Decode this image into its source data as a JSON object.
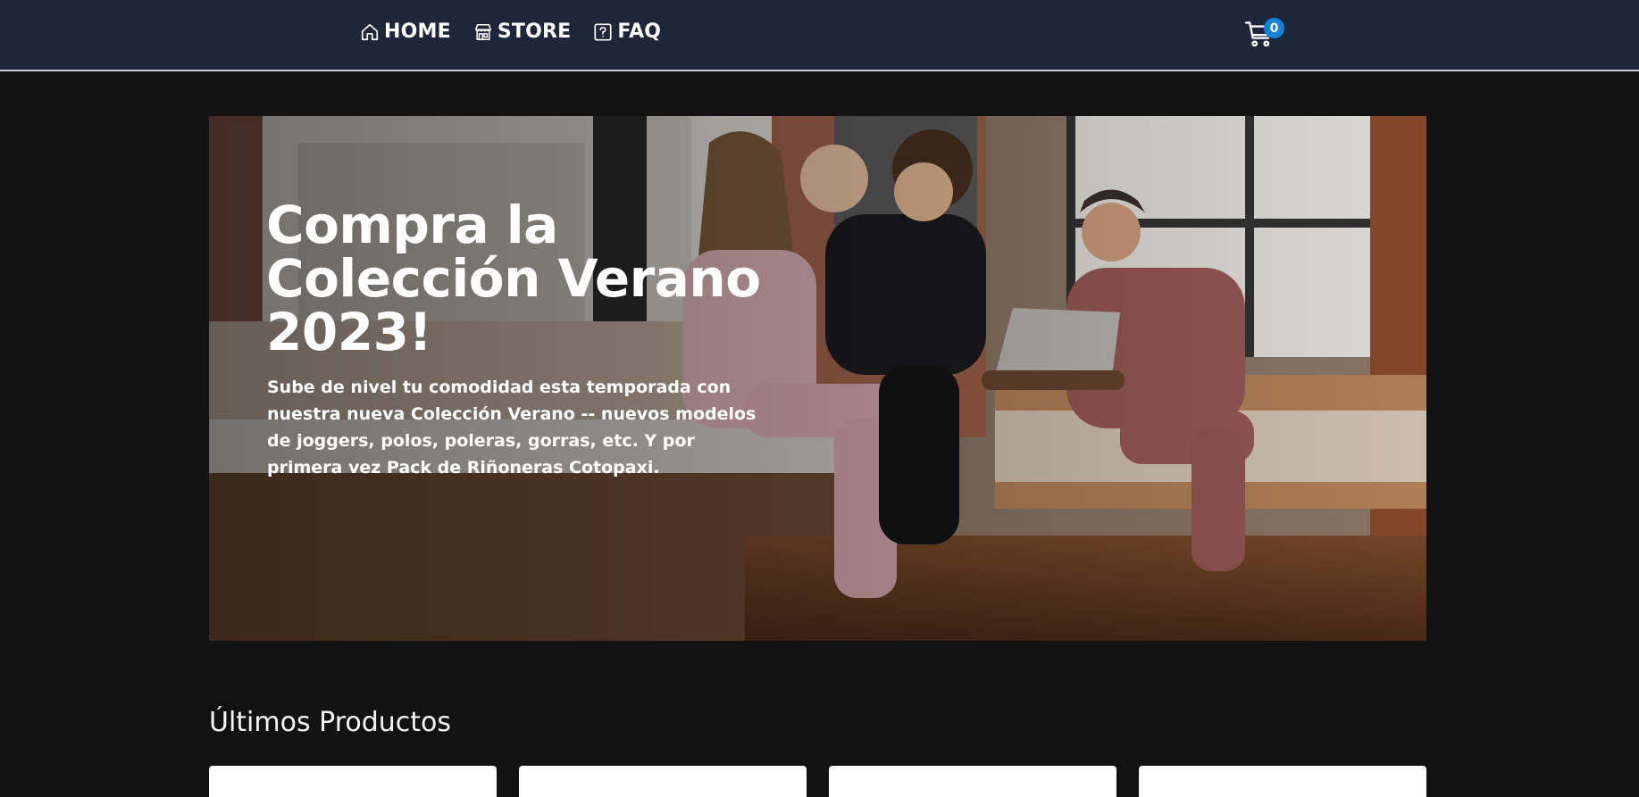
{
  "nav": {
    "items": [
      {
        "label": "HOME",
        "icon": "home-icon"
      },
      {
        "label": "STORE",
        "icon": "store-icon"
      },
      {
        "label": "FAQ",
        "icon": "question-icon"
      }
    ]
  },
  "cart": {
    "count": "0",
    "icon": "cart-icon"
  },
  "hero": {
    "title": "Compra la Colección Verano 2023!",
    "text": "Sube de nivel tu comodidad esta temporada con nuestra nueva Colección Verano -- nuevos modelos de joggers, polos, poleras, gorras, etc. Y por primera vez Pack de Riñoneras Cotopaxi."
  },
  "products": {
    "title": "Últimos Productos"
  },
  "colors": {
    "header_bg": "#1e2739",
    "page_bg": "#121212",
    "badge": "#1482d6"
  }
}
